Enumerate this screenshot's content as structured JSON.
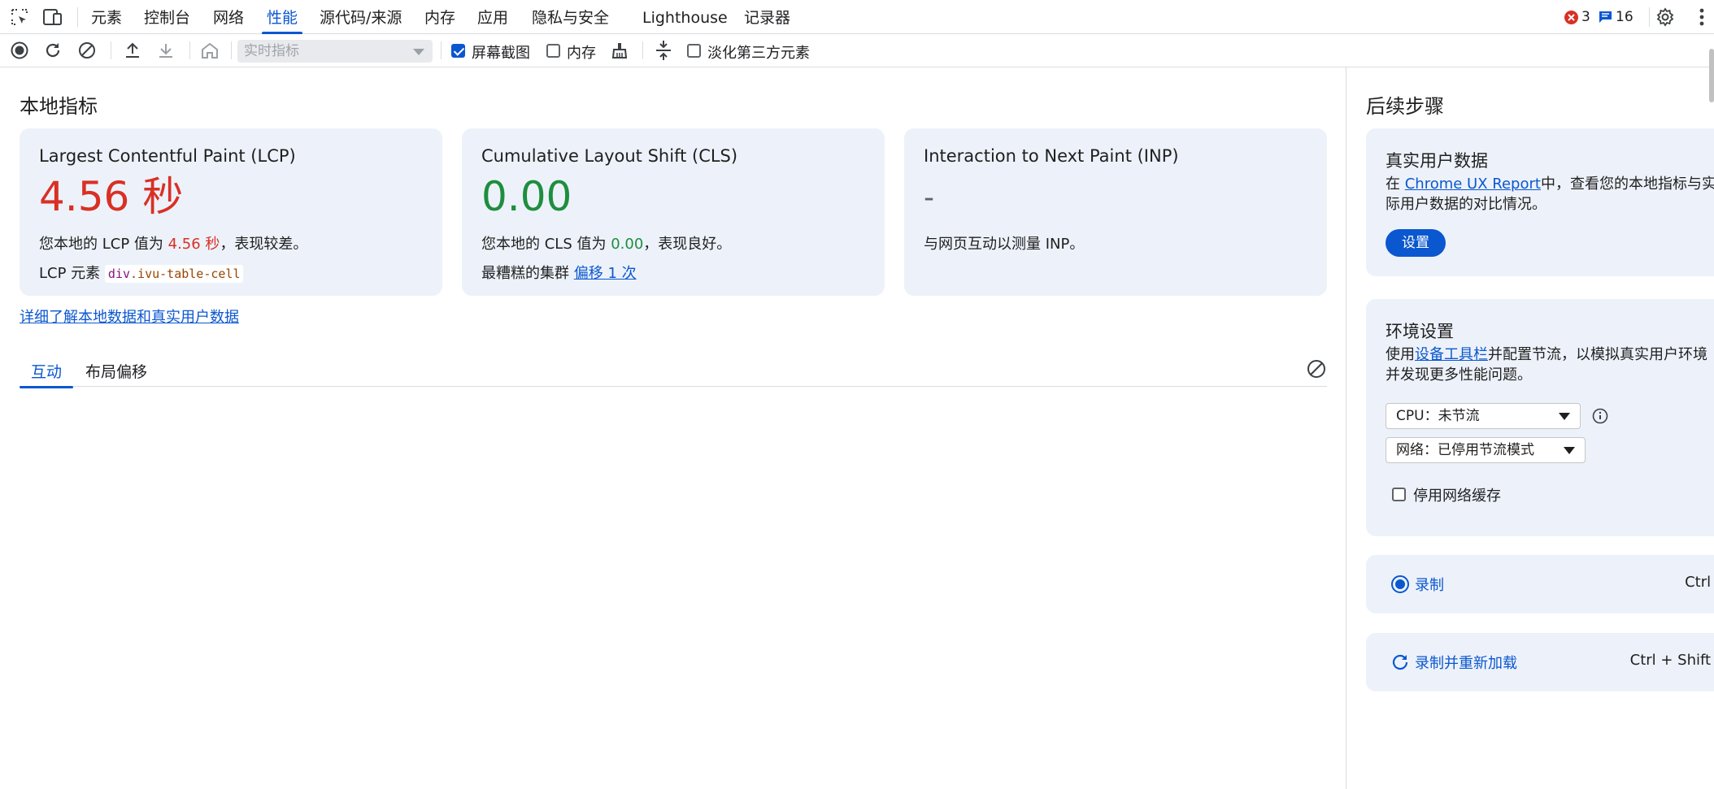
{
  "tabs": {
    "items": [
      "元素",
      "控制台",
      "网络",
      "性能",
      "源代码/来源",
      "内存",
      "应用",
      "隐私与安全",
      "Lighthouse",
      "记录器"
    ],
    "active": "性能",
    "errors_count": "3",
    "messages_count": "16"
  },
  "toolbar": {
    "select_placeholder": "实时指标",
    "screenshots_label": "屏幕截图",
    "screenshots_checked": true,
    "memory_label": "内存",
    "memory_checked": false,
    "dim_third_party_label": "淡化第三方元素",
    "dim_third_party_checked": false
  },
  "main": {
    "title": "本地指标",
    "lcp": {
      "title": "Largest Contentful Paint (LCP)",
      "value": "4.56 秒",
      "desc_prefix": "您本地的 LCP 值为 ",
      "desc_value": "4.56 秒",
      "desc_suffix": "，表现较差。",
      "element_label": "LCP 元素",
      "element_tag": "div",
      "element_class": ".ivu-table-cell"
    },
    "cls": {
      "title": "Cumulative Layout Shift (CLS)",
      "value": "0.00",
      "desc_prefix": "您本地的 CLS 值为 ",
      "desc_value": "0.00",
      "desc_suffix": "，表现良好。",
      "worst_label": "最糟糕的集群",
      "worst_link": "偏移 1 次"
    },
    "inp": {
      "title": "Interaction to Next Paint (INP)",
      "value": "-",
      "desc": "与网页互动以测量 INP。"
    },
    "learn_link": "详细了解本地数据和真实用户数据",
    "subtabs": [
      "互动",
      "布局偏移"
    ]
  },
  "sidebar": {
    "title": "后续步骤",
    "field_data": {
      "title": "真实用户数据",
      "text_prefix": "在 ",
      "link": "Chrome UX Report",
      "text_suffix": "中，查看您的本地指标与实",
      "text_line2": "际用户数据的对比情况。",
      "button": "设置"
    },
    "env": {
      "title": "环境设置",
      "text_prefix": "使用",
      "link": "设备工具栏",
      "text_suffix": "并配置节流，以模拟真实用户环境",
      "text_line2": "并发现更多性能问题。",
      "cpu": "CPU：未节流",
      "network": "网络：已停用节流模式",
      "disable_cache": "停用网络缓存"
    },
    "record": {
      "label": "录制",
      "shortcut": "Ctrl + E"
    },
    "reload": {
      "label": "录制并重新加载",
      "shortcut": "Ctrl + Shift + E"
    }
  },
  "colors": {
    "accent": "#0b57d0",
    "bad": "#d93025",
    "good": "#1e8e3e",
    "card_bg": "#edf2fa"
  }
}
